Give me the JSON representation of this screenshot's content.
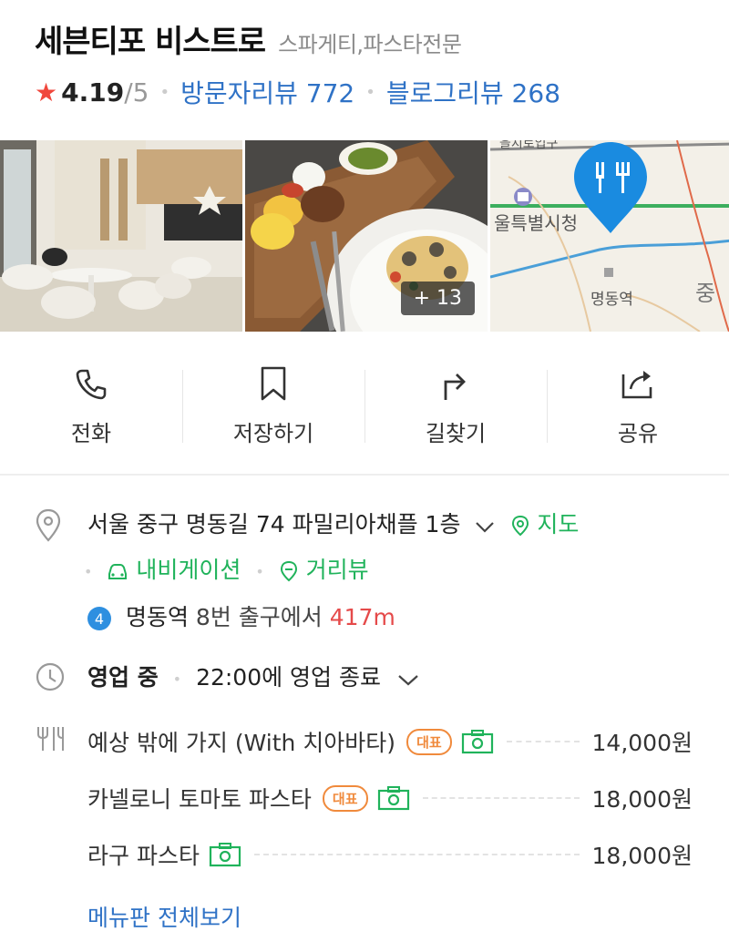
{
  "place": {
    "name": "세븐티포 비스트로",
    "category": "스파게티,파스타전문"
  },
  "rating": {
    "star": "★",
    "score": "4.19",
    "out_of": "/5",
    "visitor_reviews": "방문자리뷰 772",
    "blog_reviews": "블로그리뷰 268"
  },
  "photos": {
    "more_count": "+ 13"
  },
  "actions": [
    {
      "label": "전화",
      "icon": "phone-icon"
    },
    {
      "label": "저장하기",
      "icon": "bookmark-icon"
    },
    {
      "label": "길찾기",
      "icon": "directions-icon"
    },
    {
      "label": "공유",
      "icon": "share-icon"
    }
  ],
  "address": {
    "text": "서울 중구 명동길 74 파밀리아채플 1층",
    "map_link": "지도",
    "navigation_link": "내비게이션",
    "street_view_link": "거리뷰",
    "subway_line": "4",
    "station": "명동역",
    "exit_text": "8번 출구에서",
    "distance": "417m"
  },
  "hours": {
    "status": "영업 중",
    "detail": "22:00에 영업 종료"
  },
  "menu": {
    "items": [
      {
        "name": "예상 밖에 가지 (With 치아바타)",
        "badge": "대표",
        "price": "14,000원"
      },
      {
        "name": "카넬로니 토마토 파스타",
        "badge": "대표",
        "price": "18,000원"
      },
      {
        "name": "라구 파스타",
        "badge": "",
        "price": "18,000원"
      }
    ],
    "view_all": "메뉴판 전체보기"
  },
  "map": {
    "labels": [
      "울특별시청",
      "명동역",
      "중",
      "을지로입구"
    ]
  },
  "colors": {
    "accent_blue": "#2f72c6",
    "green": "#20b35b",
    "badge_orange": "#f08a3c",
    "star_red": "#f0473c",
    "distance_red": "#e54a4a",
    "pin_blue": "#1a8be0"
  }
}
